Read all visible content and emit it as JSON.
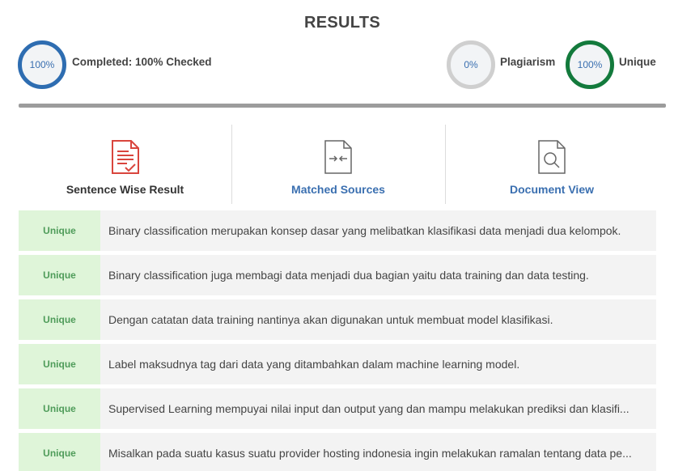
{
  "header": {
    "title": "RESULTS"
  },
  "stats": {
    "completed": {
      "value": "100%",
      "label": "Completed: 100% Checked",
      "color": "#2e6db1"
    },
    "plagiarism": {
      "value": "0%",
      "label": "Plagiarism",
      "color": "#cfcfcf"
    },
    "unique": {
      "value": "100%",
      "label": "Unique",
      "color": "#137a3c"
    }
  },
  "tabs": [
    {
      "label": "Sentence Wise Result",
      "icon": "document-check-icon",
      "active": true
    },
    {
      "label": "Matched Sources",
      "icon": "document-compare-icon",
      "active": false
    },
    {
      "label": "Document View",
      "icon": "document-search-icon",
      "active": false
    }
  ],
  "rows": [
    {
      "status": "Unique",
      "text": "Binary classification merupakan konsep dasar yang melibatkan klasifikasi data menjadi dua kelompok."
    },
    {
      "status": "Unique",
      "text": "Binary classification juga membagi data menjadi dua bagian yaitu data training dan data testing."
    },
    {
      "status": "Unique",
      "text": "Dengan catatan data training nantinya akan digunakan untuk membuat model klasifikasi."
    },
    {
      "status": "Unique",
      "text": "Label maksudnya tag dari data yang ditambahkan dalam machine learning model."
    },
    {
      "status": "Unique",
      "text": "Supervised Learning mempuyai nilai input dan output yang dan mampu melakukan prediksi dan klasifi..."
    },
    {
      "status": "Unique",
      "text": "Misalkan pada suatu kasus suatu provider hosting indonesia ingin melakukan ramalan tentang data pe..."
    }
  ]
}
